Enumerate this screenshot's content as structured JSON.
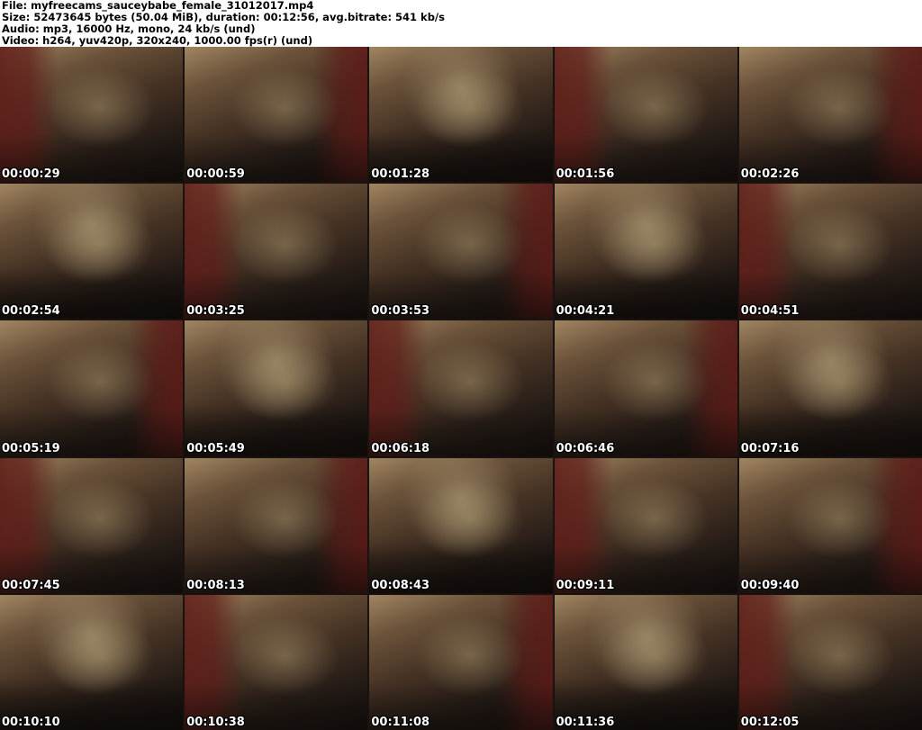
{
  "header": {
    "file_line": "File: myfreecams_sauceybabe_female_31012017.mp4",
    "size_line": "Size: 52473645 bytes (50.04 MiB), duration: 00:12:56, avg.bitrate: 541 kb/s",
    "audio_line": "Audio: mp3, 16000 Hz, mono, 24 kb/s (und)",
    "video_line": "Video: h264, yuv420p, 320x240, 1000.00 fps(r) (und)"
  },
  "grid": {
    "columns": 5,
    "rows": 5,
    "timestamps": [
      "00:00:29",
      "00:00:59",
      "00:01:28",
      "00:01:56",
      "00:02:26",
      "00:02:54",
      "00:03:25",
      "00:03:53",
      "00:04:21",
      "00:04:51",
      "00:05:19",
      "00:05:49",
      "00:06:18",
      "00:06:46",
      "00:07:16",
      "00:07:45",
      "00:08:13",
      "00:08:43",
      "00:09:11",
      "00:09:40",
      "00:10:10",
      "00:10:38",
      "00:11:08",
      "00:11:36",
      "00:12:05"
    ]
  },
  "palette": {
    "header_bg": "#ffffff",
    "header_text": "#000000",
    "timestamp_text": "#ffffff",
    "timestamp_outline": "#000000",
    "thumb_dark": "#241b16",
    "thumb_curtain_red": "#5e1b17",
    "thumb_wall_tan": "#a08868",
    "thumb_highlight": "#d8c48f",
    "grid_seam": "#181310"
  }
}
